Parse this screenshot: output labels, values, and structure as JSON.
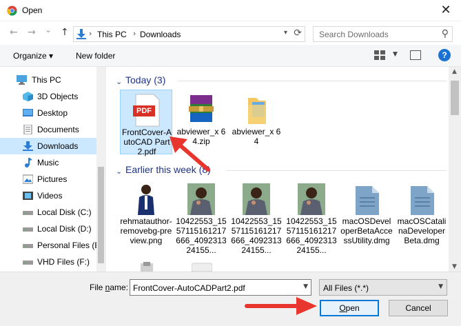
{
  "window": {
    "title": "Open",
    "close_glyph": "✕"
  },
  "nav": {
    "back_glyph": "←",
    "forward_glyph": "→",
    "recent_glyph": "⌄",
    "up_glyph": "↑",
    "address": [
      "This PC",
      "Downloads"
    ],
    "chevron": "›",
    "search_placeholder": "Search Downloads"
  },
  "toolbar": {
    "organize_label": "Organize ▾",
    "new_folder_label": "New folder",
    "help_glyph": "?"
  },
  "sidebar": {
    "items": [
      {
        "label": "This PC",
        "icon": "computer-icon"
      },
      {
        "label": "3D Objects",
        "icon": "cube-icon"
      },
      {
        "label": "Desktop",
        "icon": "desktop-icon"
      },
      {
        "label": "Documents",
        "icon": "documents-icon"
      },
      {
        "label": "Downloads",
        "icon": "download-icon",
        "selected": true
      },
      {
        "label": "Music",
        "icon": "music-icon"
      },
      {
        "label": "Pictures",
        "icon": "pictures-icon"
      },
      {
        "label": "Videos",
        "icon": "videos-icon"
      },
      {
        "label": "Local Disk (C:)",
        "icon": "drive-icon"
      },
      {
        "label": "Local Disk (D:)",
        "icon": "drive-icon"
      },
      {
        "label": "Personal Files (E:",
        "icon": "drive-icon"
      },
      {
        "label": "VHD Files (F:)",
        "icon": "drive-icon"
      }
    ]
  },
  "groups": [
    {
      "title": "Today (3)",
      "files": [
        {
          "name": "FrontCover-AutoCAD Part2.pdf",
          "type": "pdf",
          "selected": true,
          "badge": "PDF"
        },
        {
          "name": "abviewer_x 64.zip",
          "type": "zip"
        },
        {
          "name": "abviewer_x 64",
          "type": "folder"
        }
      ]
    },
    {
      "title": "Earlier this week (8)",
      "files": [
        {
          "name": "rehmatauthor-removebg-preview.png",
          "type": "photo-person"
        },
        {
          "name": "10422553_1557115161217666_409231324155...",
          "type": "photo"
        },
        {
          "name": "10422553_1557115161217666_409231324155...",
          "type": "photo"
        },
        {
          "name": "10422553_1557115161217666_409231324155...",
          "type": "photo"
        },
        {
          "name": "macOSDeveloperBetaAccessUtility.dmg",
          "type": "dmg"
        },
        {
          "name": "macOSCatalinaDeveloperBeta.dmg",
          "type": "dmg"
        }
      ]
    }
  ],
  "footer": {
    "file_name_label_pre": "File ",
    "file_name_label_u": "n",
    "file_name_label_post": "ame:",
    "file_name_value": "FrontCover-AutoCADPart2.pdf",
    "file_type_value": "All Files (*.*)",
    "open_u": "O",
    "open_rest": "pen",
    "cancel_label": "Cancel"
  },
  "colors": {
    "accent": "#0078d7",
    "selection": "#cce8ff",
    "annotation_arrow": "#e8352e"
  }
}
